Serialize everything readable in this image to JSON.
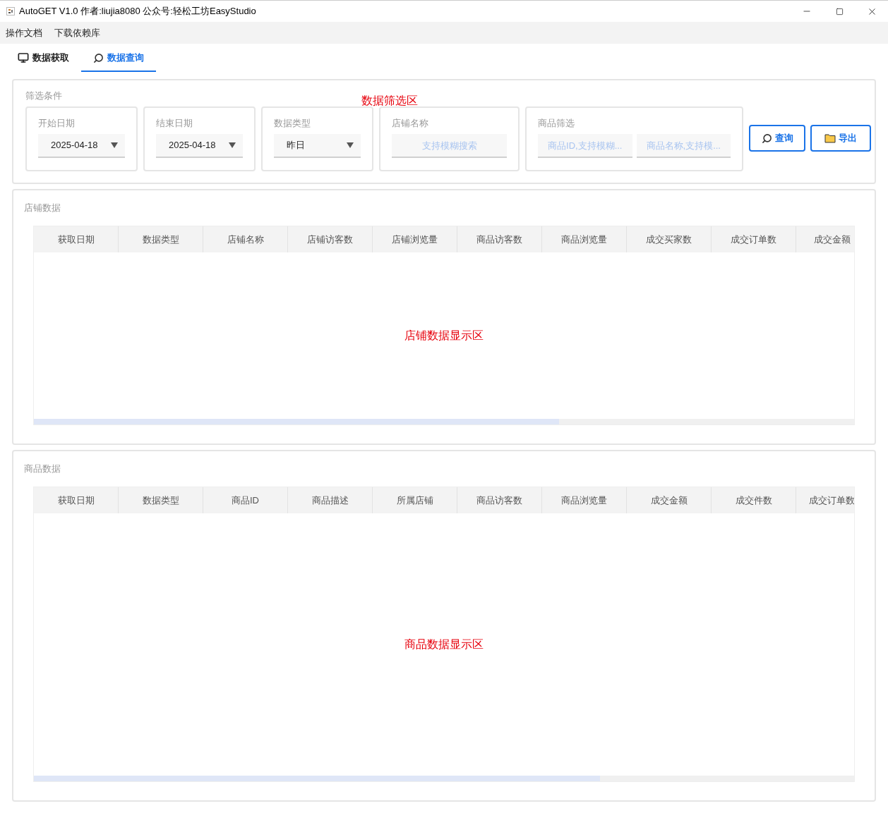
{
  "window": {
    "title": "AutoGET V1.0 作者:liujia8080 公众号:轻松工坊EasyStudio"
  },
  "menu": [
    "操作文档",
    "下载依赖库"
  ],
  "tabs": [
    {
      "label": "数据获取",
      "kind": "monitor",
      "selected": false
    },
    {
      "label": "数据查询",
      "kind": "search",
      "selected": true
    }
  ],
  "filter": {
    "title": "筛选条件",
    "annotation": "数据筛选区",
    "groups": [
      {
        "kind": "select",
        "label": "开始日期",
        "value": "2025-04-18"
      },
      {
        "kind": "select",
        "label": "结束日期",
        "value": "2025-04-18"
      },
      {
        "kind": "select",
        "label": "数据类型",
        "value": "昨日"
      },
      {
        "kind": "inputs",
        "label": "店铺名称",
        "placeholders": [
          "支持模糊搜索"
        ]
      },
      {
        "kind": "inputs",
        "label": "商品筛选",
        "placeholders": [
          "商品ID,支持模糊...",
          "商品名称,支持模..."
        ]
      }
    ],
    "buttons": [
      {
        "label": "查询",
        "kind": "search"
      },
      {
        "label": "导出",
        "kind": "folder"
      }
    ]
  },
  "store_data": {
    "title": "店铺数据",
    "annotation": "店铺数据显示区",
    "columns": [
      "获取日期",
      "数据类型",
      "店铺名称",
      "店铺访客数",
      "店铺浏览量",
      "商品访客数",
      "商品浏览量",
      "成交买家数",
      "成交订单数",
      "成交金额"
    ]
  },
  "product_data": {
    "title": "商品数据",
    "annotation": "商品数据显示区",
    "columns": [
      "获取日期",
      "数据类型",
      "商品ID",
      "商品描述",
      "所属店铺",
      "商品访客数",
      "商品浏览量",
      "成交金额",
      "成交件数",
      "成交订单数"
    ]
  }
}
